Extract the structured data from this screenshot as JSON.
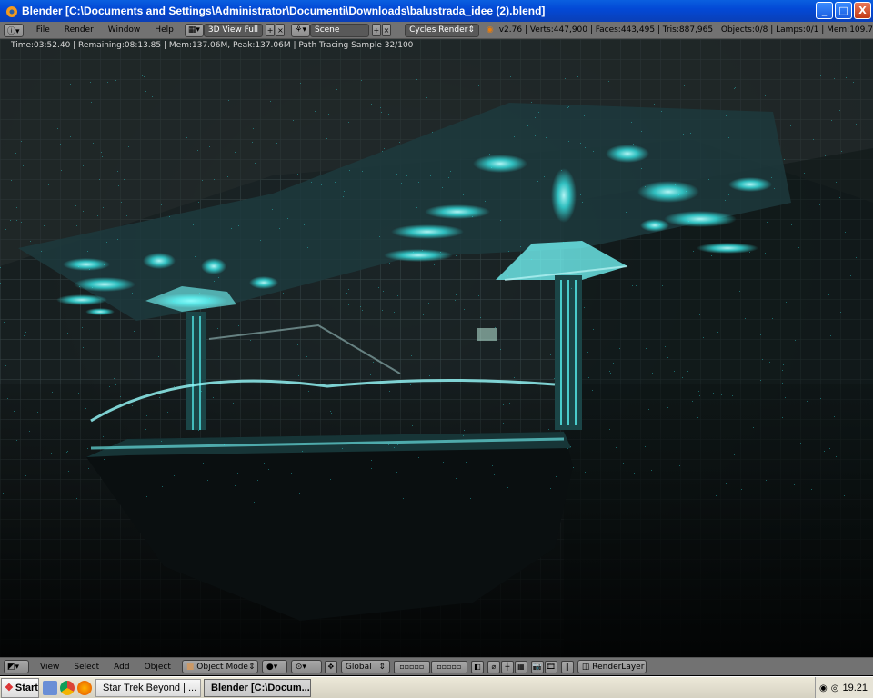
{
  "window": {
    "title": "Blender [C:\\Documents and Settings\\Administrator\\Documenti\\Downloads\\balustrada_idee (2).blend]",
    "minimize": "_",
    "maximize": "□",
    "close": "X"
  },
  "header": {
    "menus": [
      "File",
      "Render",
      "Window",
      "Help"
    ],
    "screen_layout": "3D View Full",
    "scene": "Scene",
    "render_engine": "Cycles Render",
    "stats": "v2.76 | Verts:447,900 | Faces:443,495 | Tris:887,965 | Objects:0/8 | Lamps:0/1 | Mem:109.7"
  },
  "viewport": {
    "render_info": "Time:03:52.40 | Remaining:08:13.85 | Mem:137.06M, Peak:137.06M | Path Tracing Sample 32/100"
  },
  "footer": {
    "menus": [
      "View",
      "Select",
      "Add",
      "Object"
    ],
    "mode": "Object Mode",
    "orientation": "Global",
    "render_layer": "RenderLayer"
  },
  "taskbar": {
    "start": "Start",
    "tasks": [
      "Star Trek Beyond | ...",
      "Blender [C:\\Docum..."
    ],
    "clock": "19.21"
  },
  "colors": {
    "glow": "#35d8d8",
    "header_bg": "#727272",
    "title_blue": "#0349d6"
  }
}
